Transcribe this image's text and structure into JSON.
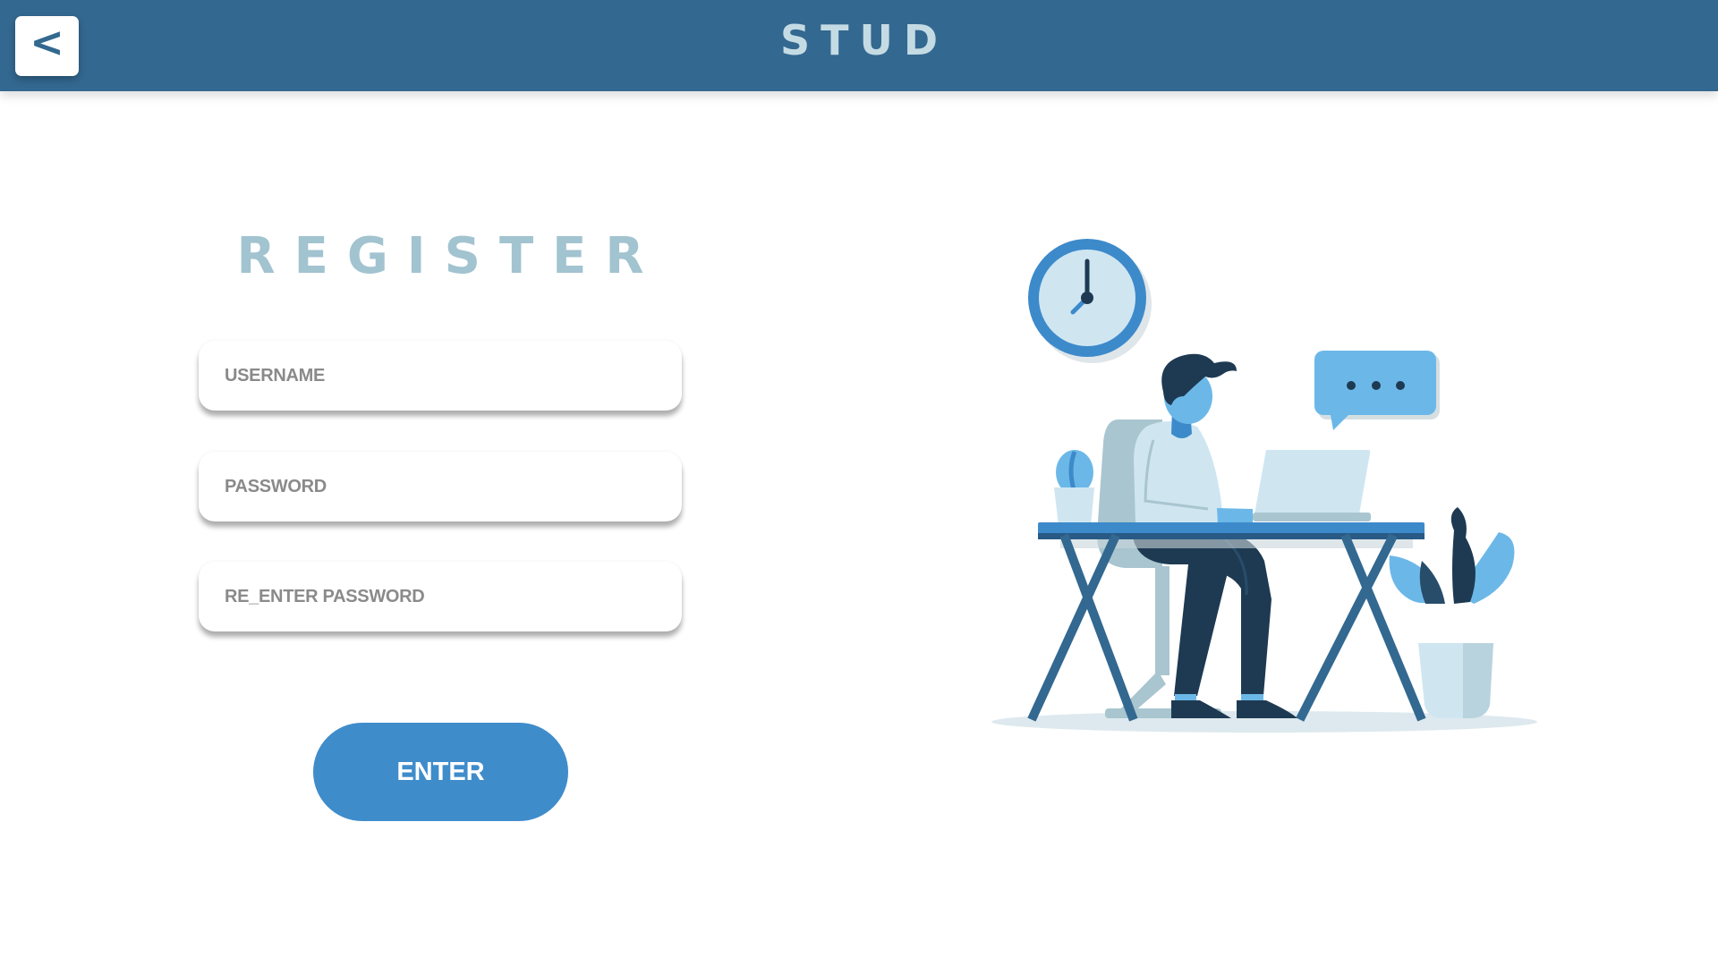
{
  "header": {
    "back_label": "<",
    "title": "STUD"
  },
  "form": {
    "title": "REGISTER",
    "username_placeholder": "USERNAME",
    "password_placeholder": "PASSWORD",
    "reenter_placeholder": "RE_ENTER PASSWORD",
    "enter_label": "ENTER"
  },
  "illustration": {
    "subject": "person-working-at-laptop",
    "chat_bubble_text": "..."
  },
  "colors": {
    "header_bg": "#336890",
    "title_text": "#c5dbe4",
    "register_title": "#a2c3d0",
    "button_bg": "#3f8ccb",
    "accent_light": "#6bb8e8",
    "dark_navy": "#1e3a52"
  }
}
